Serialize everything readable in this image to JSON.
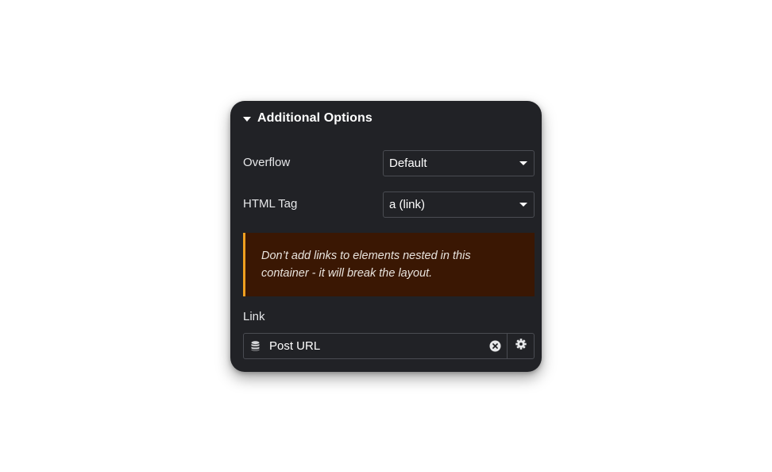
{
  "section": {
    "title": "Additional Options"
  },
  "overflow": {
    "label": "Overflow",
    "value": "Default"
  },
  "html_tag": {
    "label": "HTML Tag",
    "value": "a (link)"
  },
  "notice": {
    "line1": "Don’t add links to elements nested in this",
    "line2": "container - it will break the layout."
  },
  "link": {
    "label": "Link",
    "value": "Post URL"
  },
  "icons": {
    "section_toggle": "caret-down-icon",
    "dynamic": "database-icon",
    "clear": "clear-circle-icon",
    "settings": "gear-icon"
  },
  "colors": {
    "panel_bg": "#212226",
    "notice_bg": "#3a1703",
    "notice_border": "#f0a020",
    "text": "#e6e7e9",
    "border": "#4a4c52"
  }
}
